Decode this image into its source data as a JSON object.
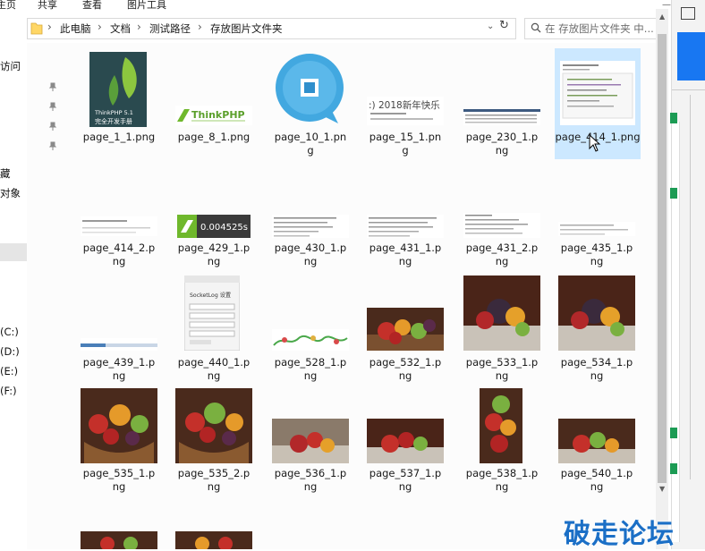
{
  "ribbon": {
    "tabs": [
      "主页",
      "共享",
      "查看",
      "图片工具"
    ]
  },
  "address": {
    "breadcrumbs": [
      "此电脑",
      "文档",
      "测试路径",
      "存放图片文件夹"
    ],
    "separator": "›",
    "dropdown": "⌄",
    "refresh": "↻"
  },
  "search": {
    "placeholder": "在 存放图片文件夹 中..."
  },
  "window": {
    "minimize": "—",
    "close": "×"
  },
  "nav": {
    "items": [
      "访问",
      "藏",
      "对象",
      "(C:)",
      "(D:)",
      "(E:)",
      "(F:)"
    ]
  },
  "files": [
    {
      "name": "page_1_1.png"
    },
    {
      "name": "page_8_1.png"
    },
    {
      "name": "page_10_1.png"
    },
    {
      "name": "page_15_1.png"
    },
    {
      "name": "page_230_1.png"
    },
    {
      "name": "page_414_1.png"
    },
    {
      "name": "page_414_2.png"
    },
    {
      "name": "page_429_1.png"
    },
    {
      "name": "page_430_1.png"
    },
    {
      "name": "page_431_1.png"
    },
    {
      "name": "page_431_2.png"
    },
    {
      "name": "page_435_1.png"
    },
    {
      "name": "page_439_1.png"
    },
    {
      "name": "page_440_1.png"
    },
    {
      "name": "page_528_1.png"
    },
    {
      "name": "page_532_1.png"
    },
    {
      "name": "page_533_1.png"
    },
    {
      "name": "page_534_1.png"
    },
    {
      "name": "page_535_1.png"
    },
    {
      "name": "page_535_2.png"
    },
    {
      "name": "page_536_1.png"
    },
    {
      "name": "page_537_1.png"
    },
    {
      "name": "page_538_1.png"
    },
    {
      "name": "page_540_1.png"
    },
    {
      "name": ""
    },
    {
      "name": ""
    }
  ],
  "selected_index": 5,
  "thumbs": {
    "book_title": "ThinkPHP 5.1",
    "book_sub": "完全开发手册",
    "logo_text": "ThinkPHP",
    "newyear_text": ":) 2018新年快乐",
    "time_value": "0.004525s",
    "socketlog_title": "SocketLog 设置"
  },
  "watermark": "破走论坛"
}
